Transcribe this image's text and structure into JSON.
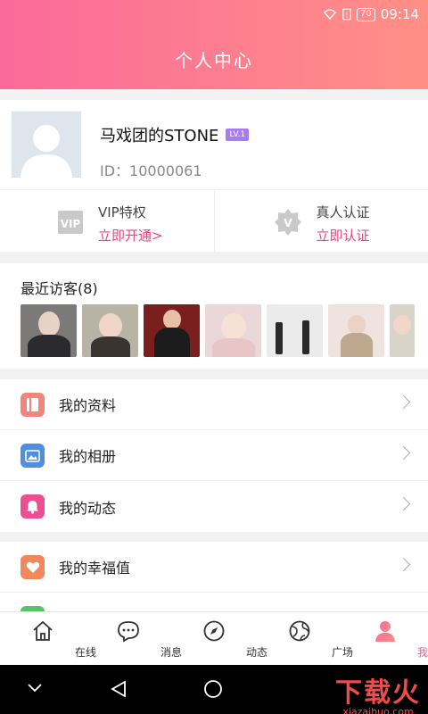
{
  "status": {
    "battery": "70",
    "time": "09:14"
  },
  "header": {
    "title": "个人中心"
  },
  "profile": {
    "name": "马戏团的STONE",
    "level": "LV.1",
    "uid": "ID：10000061"
  },
  "privileges": [
    {
      "label": "VIP特权",
      "action": "立即开通>"
    },
    {
      "label": "真人认证",
      "action": "立即认证"
    }
  ],
  "visitors": {
    "title": "最近访客(8)"
  },
  "menu": [
    {
      "label": "我的资料",
      "color": "#f1857b"
    },
    {
      "label": "我的相册",
      "color": "#4e8fe2"
    },
    {
      "label": "我的动态",
      "color": "#ec4f8f"
    },
    {
      "label": "我的幸福值",
      "color": "#f0885a"
    }
  ],
  "tabs": [
    "在线",
    "消息",
    "动态",
    "广场",
    "我的"
  ],
  "watermark": {
    "main": "下载火",
    "sub": "xiazaihuo.com"
  }
}
